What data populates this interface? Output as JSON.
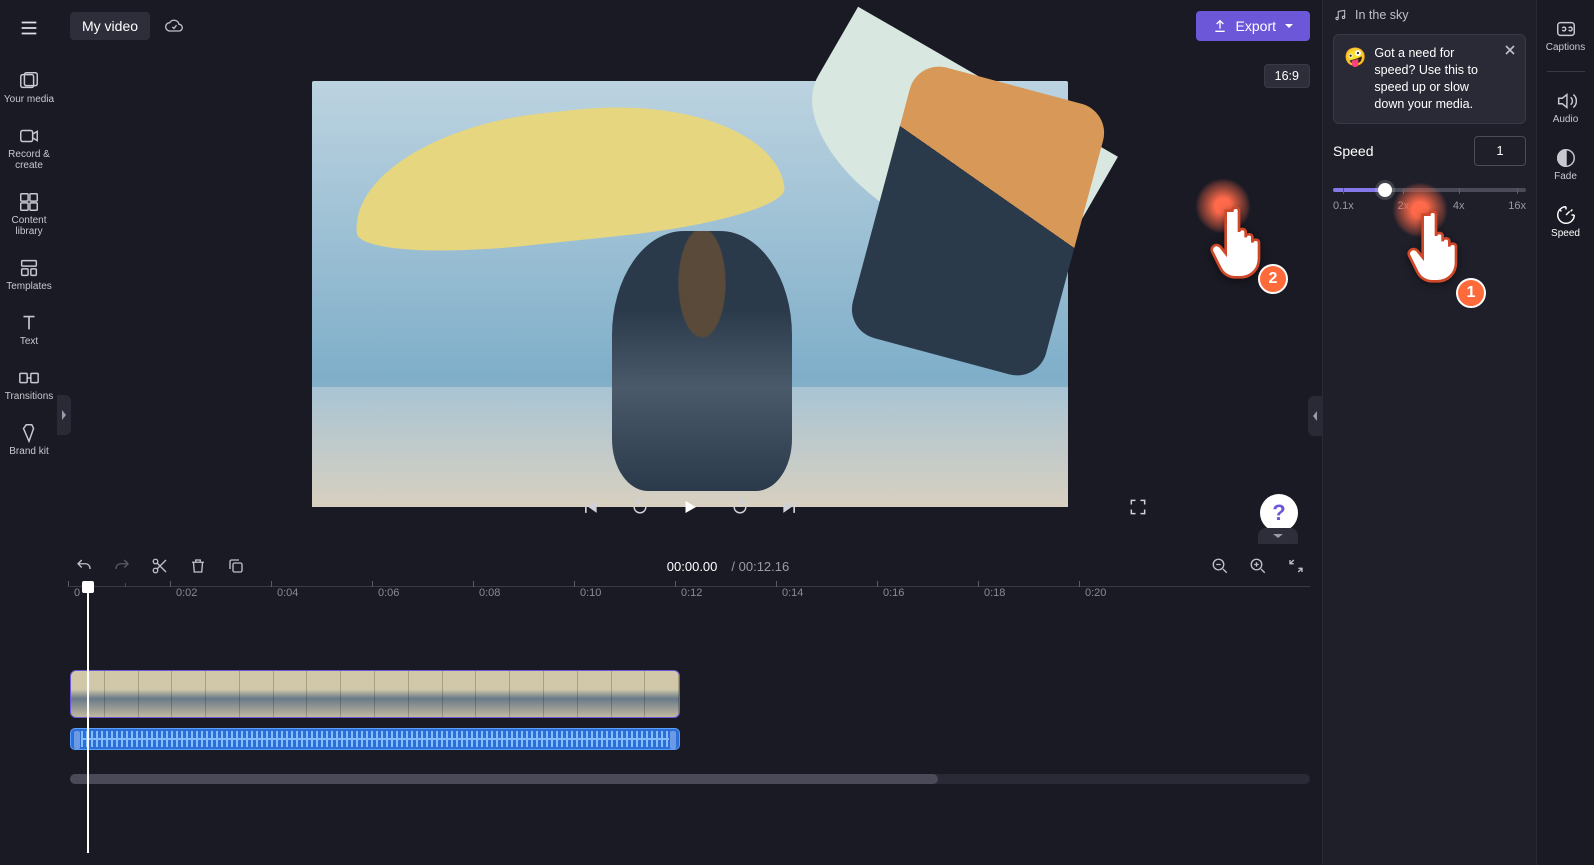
{
  "project": {
    "title": "My video"
  },
  "export": {
    "label": "Export"
  },
  "aspect_ratio": "16:9",
  "left_rail": {
    "items": [
      {
        "label": "Your media"
      },
      {
        "label": "Record & create"
      },
      {
        "label": "Content library"
      },
      {
        "label": "Templates"
      },
      {
        "label": "Text"
      },
      {
        "label": "Transitions"
      },
      {
        "label": "Brand kit"
      }
    ]
  },
  "right_rail": {
    "items": [
      {
        "label": "Captions"
      },
      {
        "label": "Audio"
      },
      {
        "label": "Fade"
      },
      {
        "label": "Speed"
      }
    ]
  },
  "audio_info": {
    "track_name": "In the sky"
  },
  "tip": {
    "emoji": "🤪",
    "text": "Got a need for speed? Use this to speed up or slow down your media."
  },
  "speed": {
    "label": "Speed",
    "value": "1",
    "ticks": [
      "0.1x",
      "2x",
      "4x",
      "16x"
    ]
  },
  "timeline": {
    "current": "00:00.00",
    "total": "00:12.16",
    "ruler_start": "0",
    "marks": [
      "0:02",
      "0:04",
      "0:06",
      "0:08",
      "0:10",
      "0:12",
      "0:14",
      "0:16",
      "0:18",
      "0:20"
    ]
  },
  "markers": {
    "one": "1",
    "two": "2"
  },
  "help": "?"
}
